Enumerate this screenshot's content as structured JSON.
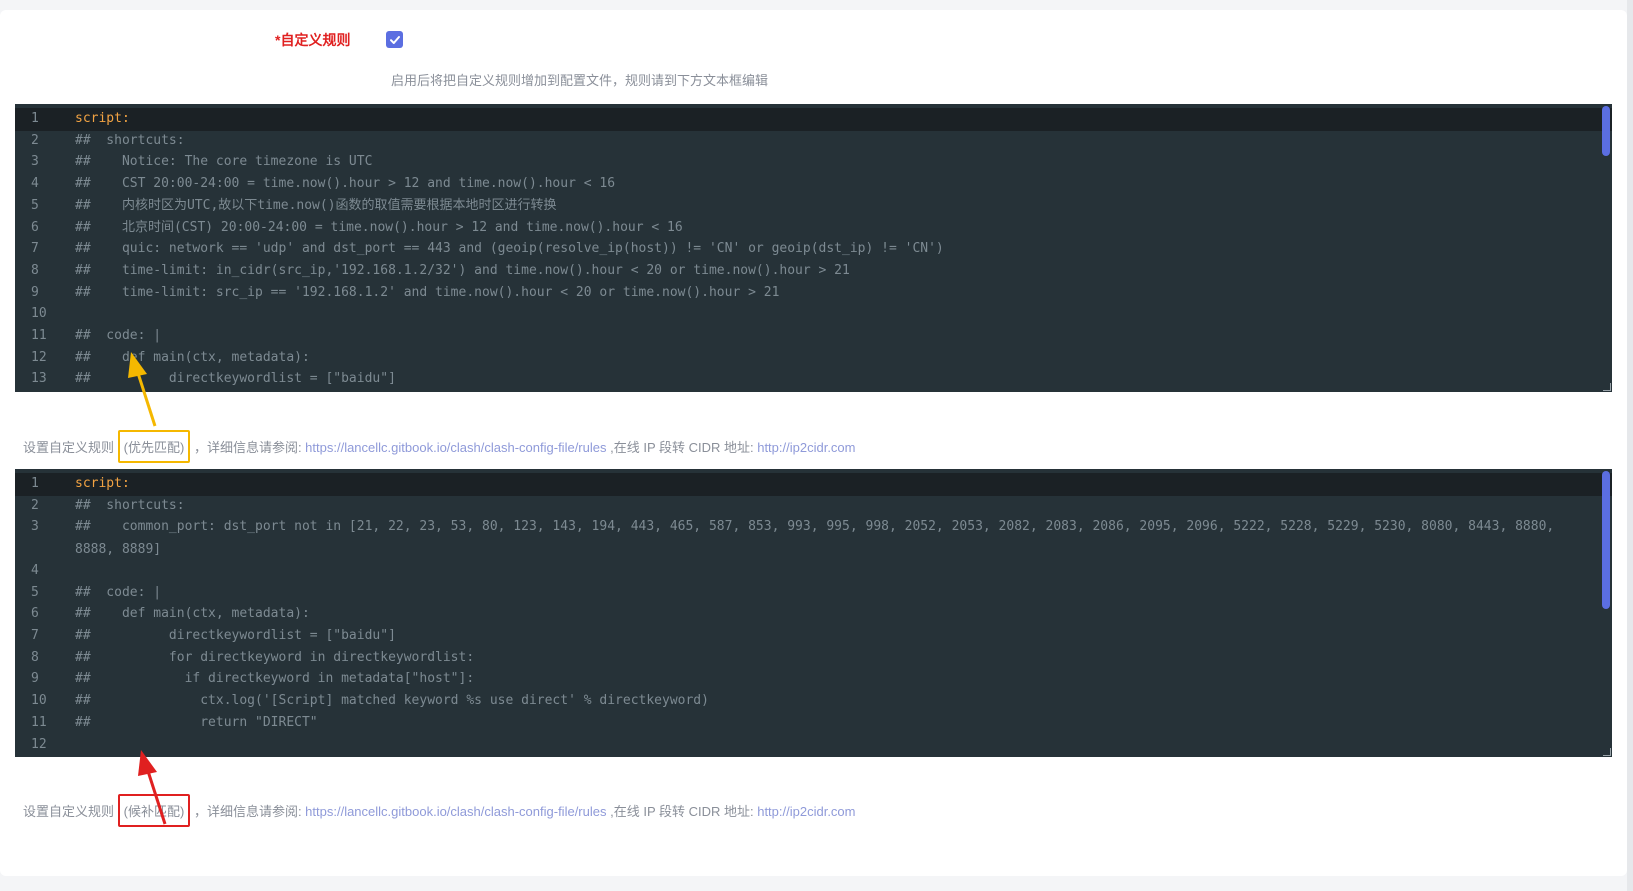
{
  "form": {
    "label": "*自定义规则",
    "checkbox_checked": true,
    "hint": "启用后将把自定义规则增加到配置文件，规则请到下方文本框编辑"
  },
  "editor1": {
    "lines": [
      {
        "n": "1",
        "text": "script:"
      },
      {
        "n": "2",
        "text": "##  shortcuts:"
      },
      {
        "n": "3",
        "text": "##    Notice: The core timezone is UTC"
      },
      {
        "n": "4",
        "text": "##    CST 20:00-24:00 = time.now().hour > 12 and time.now().hour < 16"
      },
      {
        "n": "5",
        "text": "##    内核时区为UTC,故以下time.now()函数的取值需要根据本地时区进行转换"
      },
      {
        "n": "6",
        "text": "##    北京时间(CST) 20:00-24:00 = time.now().hour > 12 and time.now().hour < 16"
      },
      {
        "n": "7",
        "text": "##    quic: network == 'udp' and dst_port == 443 and (geoip(resolve_ip(host)) != 'CN' or geoip(dst_ip) != 'CN')"
      },
      {
        "n": "8",
        "text": "##    time-limit: in_cidr(src_ip,'192.168.1.2/32') and time.now().hour < 20 or time.now().hour > 21"
      },
      {
        "n": "9",
        "text": "##    time-limit: src_ip == '192.168.1.2' and time.now().hour < 20 or time.now().hour > 21"
      },
      {
        "n": "10",
        "text": ""
      },
      {
        "n": "11",
        "text": "##  code: |"
      },
      {
        "n": "12",
        "text": "##    def main(ctx, metadata):"
      },
      {
        "n": "13",
        "text": "##          directkeywordlist = [\"baidu\"]"
      }
    ]
  },
  "desc1": {
    "prefix": "设置自定义规则",
    "tag": "(优先匹配)",
    "mid": "，详细信息请参阅: ",
    "link1": "https://lancellc.gitbook.io/clash/clash-config-file/rules",
    "mid2": " ,在线 IP 段转 CIDR 地址: ",
    "link2": "http://ip2cidr.com"
  },
  "editor2": {
    "lines": [
      {
        "n": "1",
        "text": "script:"
      },
      {
        "n": "2",
        "text": "##  shortcuts:"
      },
      {
        "n": "3",
        "text": "##    common_port: dst_port not in [21, 22, 23, 53, 80, 123, 143, 194, 443, 465, 587, 853, 993, 995, 998, 2052, 2053, 2082, 2083, 2086, 2095, 2096, 5222, 5228, 5229, 5230, 8080, 8443, 8880, 8888, 8889]"
      },
      {
        "n": "4",
        "text": ""
      },
      {
        "n": "5",
        "text": "##  code: |"
      },
      {
        "n": "6",
        "text": "##    def main(ctx, metadata):"
      },
      {
        "n": "7",
        "text": "##          directkeywordlist = [\"baidu\"]"
      },
      {
        "n": "8",
        "text": "##          for directkeyword in directkeywordlist:"
      },
      {
        "n": "9",
        "text": "##            if directkeyword in metadata[\"host\"]:"
      },
      {
        "n": "10",
        "text": "##              ctx.log('[Script] matched keyword %s use direct' % directkeyword)"
      },
      {
        "n": "11",
        "text": "##              return \"DIRECT\""
      },
      {
        "n": "12",
        "text": ""
      }
    ]
  },
  "desc2": {
    "prefix": "设置自定义规则",
    "tag": "(候补匹配)",
    "mid": "，详细信息请参阅: ",
    "link1": "https://lancellc.gitbook.io/clash/clash-config-file/rules",
    "mid2": " ,在线 IP 段转 CIDR 地址: ",
    "link2": "http://ip2cidr.com"
  },
  "colors": {
    "accent": "#5b6ee1",
    "required": "#e02020",
    "highlight_yellow": "#f5b800",
    "highlight_red": "#e02020",
    "editor_bg": "#263238",
    "keyword": "#f2a343"
  }
}
